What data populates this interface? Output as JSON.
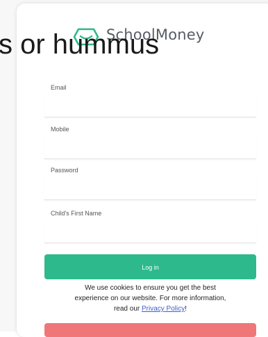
{
  "brand": {
    "name": "SchoolMoney"
  },
  "overlay_text": "s or hummus",
  "form": {
    "email_label": "Email",
    "mobile_label": "Mobile",
    "password_label": "Password",
    "child_name_label": "Child's First Name",
    "login_label": "Log in"
  },
  "cookie_notice": {
    "line1": "We use cookies to ensure you get the best",
    "line2": "experience on our website. For more information,",
    "line3_prefix": "read our ",
    "link_text": "Privacy Policy",
    "line3_suffix": "!"
  },
  "colors": {
    "primary": "#2db98b",
    "secondary_button": "#f07777",
    "link": "#3a5fcd"
  },
  "icons": {
    "logo": "wallet-smile-icon"
  }
}
